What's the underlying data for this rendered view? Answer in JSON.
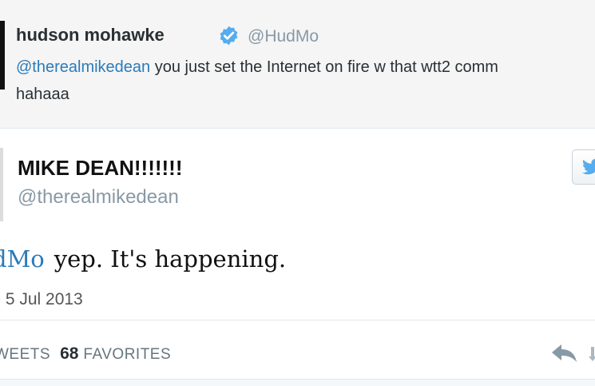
{
  "context_tweet": {
    "display_name": "hudson mohawke",
    "handle": "@HudMo",
    "mention": "@therealmikedean",
    "text_after_mention": " you just set the Internet on fire w that wtt2 comm",
    "text_line2": "hahaaa",
    "verified_icon": "verified-badge-icon"
  },
  "main_tweet": {
    "display_name": "MIKE DEAN!!!!!!!",
    "handle": "@therealmikedean",
    "mention": "dMo",
    "text": "yep. It's happening.",
    "date": "- 5 Jul 2013",
    "follow_icon": "twitter-bird-icon"
  },
  "stats": {
    "retweets_label": "WEETS",
    "favorites_count": "68",
    "favorites_label": "FAVORITES"
  },
  "actions": {
    "reply_icon": "reply-icon",
    "retweet_icon": "retweet-icon"
  },
  "colors": {
    "link": "#2b7bb9",
    "verified": "#55acee",
    "muted": "#8899a6",
    "context_bg": "#f5f5f5"
  }
}
